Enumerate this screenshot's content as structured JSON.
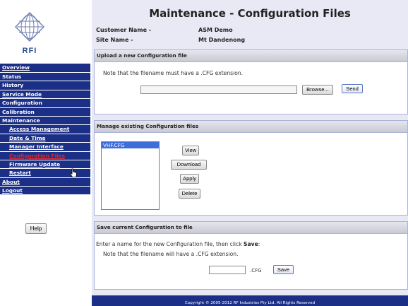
{
  "logo": {
    "text": "RFI",
    "icon": "globe-logo-icon"
  },
  "nav": {
    "items": [
      {
        "label": "Overview",
        "link": true,
        "sub": false
      },
      {
        "label": "Status",
        "link": false,
        "sub": false
      },
      {
        "label": "History",
        "link": false,
        "sub": false
      },
      {
        "label": "Service Mode",
        "link": true,
        "sub": false
      },
      {
        "label": "Configuration",
        "link": false,
        "sub": false
      },
      {
        "label": "Calibration",
        "link": false,
        "sub": false
      },
      {
        "label": "Maintenance",
        "link": false,
        "sub": false
      },
      {
        "label": "Access Management",
        "link": true,
        "sub": true
      },
      {
        "label": "Date & Time",
        "link": true,
        "sub": true
      },
      {
        "label": "Manager Interface",
        "link": true,
        "sub": true
      },
      {
        "label": "Configuration Files",
        "link": true,
        "sub": true,
        "active": true
      },
      {
        "label": "Firmware Update",
        "link": true,
        "sub": true
      },
      {
        "label": "Restart",
        "link": true,
        "sub": true
      },
      {
        "label": "About",
        "link": true,
        "sub": false
      },
      {
        "label": "Logout",
        "link": true,
        "sub": false
      }
    ],
    "help_label": "Help"
  },
  "page": {
    "title": "Maintenance - Configuration Files",
    "customer_label": "Customer Name -",
    "customer_value": "ASM Demo",
    "site_label": "Site Name -",
    "site_value": "Mt Dandenong"
  },
  "upload": {
    "heading": "Upload a new Configuration file",
    "note": "Note that the filename must have a .CFG extension.",
    "file_value": "",
    "browse_label": "Browse...",
    "send_label": "Send"
  },
  "manage": {
    "heading": "Manage existing Configuration files",
    "files": [
      "VHF.CFG"
    ],
    "view_label": "View",
    "download_label": "Download",
    "apply_label": "Apply",
    "delete_label": "Delete"
  },
  "save": {
    "heading": "Save current Configuration to file",
    "instruction_prefix": "Enter a name for the new Configuration file, then click ",
    "instruction_bold": "Save",
    "instruction_suffix": ":",
    "note": "Note that the filename will have a .CFG extension.",
    "name_value": "",
    "ext_label": ".CFG",
    "save_label": "Save"
  },
  "footer": {
    "text": "Copyright © 2005-2012 RF Industries Pty Ltd. All Rights Reserved"
  },
  "colors": {
    "nav_bg": "#1c2f86",
    "active_nav": "#e0282c",
    "main_bg": "#e9e9f6",
    "selected_item": "#3e6edb"
  }
}
